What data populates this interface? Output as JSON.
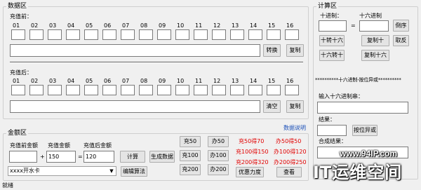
{
  "data_zone": {
    "legend": "数据区",
    "before_label": "充值前：",
    "after_label": "充值后：",
    "col_numbers": [
      "01",
      "02",
      "03",
      "04",
      "05",
      "06",
      "07",
      "08",
      "09",
      "10",
      "11",
      "12",
      "13",
      "14",
      "15",
      "16"
    ],
    "convert_button": "转换",
    "copy_button_1": "复制",
    "clear_button": "清空",
    "copy_button_2": "复制"
  },
  "calc_zone": {
    "legend": "计算区",
    "decimal_label": "十进制：",
    "hex_label": "十六进制",
    "equals": "=",
    "reverse_button": "倒序",
    "dec_to_hex_button": "十转十六",
    "copy_dec_button": "复制十",
    "negate_button": "取反",
    "hex_to_dec_button": "十六转十",
    "copy_hex_button": "复制十六",
    "xor_title": "**********十六进制-按位异或**********",
    "input_hex_label": "输入十六进制串：",
    "result_label": "结果：",
    "xor_button": "按位异或",
    "combined_label": "合成结果："
  },
  "amount_zone": {
    "legend": "金额区",
    "data_note_link": "数据说明",
    "pre_amount_label": "充值前金额",
    "charge_amount_label": "充值金额",
    "post_amount_label": "充值后金额",
    "plus": "+",
    "equals": "=",
    "pre_amount_value": "",
    "charge_amount_value": "150",
    "post_amount_value": "120",
    "calc_button": "计算",
    "gen_data_button": "生成数据",
    "card_select_value": "xxxx开水卡",
    "edit_algo_button": "编辑算法",
    "quick_buttons": [
      "充50",
      "办50",
      "充100",
      "办100",
      "充200",
      "办200"
    ],
    "promos_left": [
      "充50得70",
      "充100得150",
      "充200得320"
    ],
    "promos_right": [
      "办50得50",
      "办100得120",
      "办200得250"
    ],
    "promo_button": "优惠力度",
    "view_button": "查看"
  },
  "status_bar": {
    "text": "就绪"
  },
  "watermark": {
    "url": "www.94IP.com",
    "brand": "IT运维空间"
  }
}
